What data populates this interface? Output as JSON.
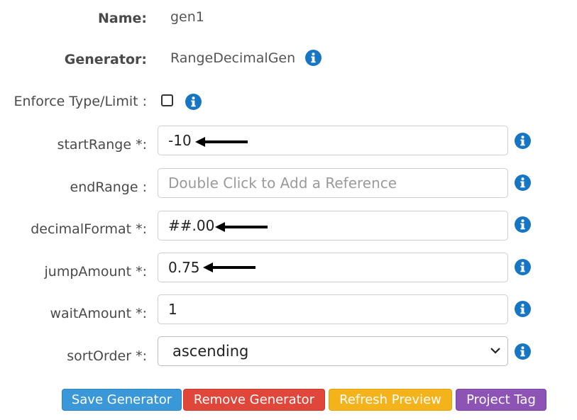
{
  "form": {
    "name_label": "Name:",
    "name_value": "gen1",
    "generator_label": "Generator:",
    "generator_value": "RangeDecimalGen",
    "enforce_label": "Enforce Type/Limit :",
    "enforce_checked": false,
    "fields": [
      {
        "label": "startRange *:",
        "value": "-10",
        "placeholder": ""
      },
      {
        "label": "endRange :",
        "value": "",
        "placeholder": "Double Click to Add a Reference"
      },
      {
        "label": "decimalFormat *:",
        "value": "##.00",
        "placeholder": ""
      },
      {
        "label": "jumpAmount *:",
        "value": "0.75",
        "placeholder": ""
      },
      {
        "label": "waitAmount *:",
        "value": "1",
        "placeholder": ""
      }
    ],
    "sort": {
      "label": "sortOrder *:",
      "selected": "ascending"
    }
  },
  "buttons": {
    "save": "Save Generator",
    "remove": "Remove Generator",
    "refresh": "Refresh Preview",
    "tag": "Project Tag"
  },
  "colors": {
    "info": "#1676c4",
    "save": "#3a97d8",
    "remove": "#e0463a",
    "refresh": "#f5b31b",
    "tag": "#8e54b5"
  },
  "icons": [
    "info-icon",
    "arrow-left-icon",
    "chevron-down-icon"
  ]
}
